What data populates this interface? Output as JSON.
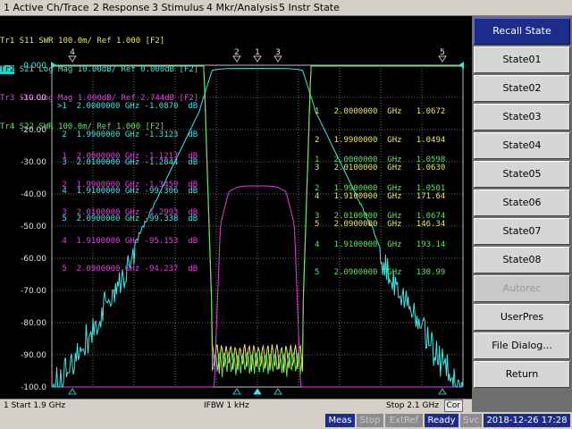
{
  "menu": [
    {
      "label": "1 Active Ch/Trace"
    },
    {
      "label": "2 Response"
    },
    {
      "label": "3 Stimulus"
    },
    {
      "label": "4 Mkr/Analysis"
    },
    {
      "label": "5 Instr State"
    }
  ],
  "traces": [
    {
      "label": "Tr1 S11 SWR 100.0m/ Ref 1.000 [F2]",
      "color": "#e6e65a"
    },
    {
      "label": "S21 Log Mag 10.00dB/ Ref 0.000dB [F2]",
      "tag": "Tr2",
      "color": "#3ce6e6"
    },
    {
      "label": "Tr3 S12 Log Mag 1.000dB/ Ref 2.744dB [F2]",
      "color": "#e63ce6"
    },
    {
      "label": "Tr4 S22 SWR 100.0m/ Ref 1.000 [F2]",
      "color": "#5ae65a"
    }
  ],
  "y_axis": {
    "ref_label": "0.000",
    "ticks": [
      "-10.00",
      "-20.00",
      "-30.00",
      "-40.00",
      "-50.00",
      "-60.00",
      "-70.00",
      "-80.00",
      "-90.00",
      "-100.0"
    ]
  },
  "marker_tables": {
    "s21": [
      ">1  2.0000000 GHz -1.0870  dB",
      " 2  1.9900000 GHz -1.3123  dB",
      " 3  2.0100000 GHz -1.2844  dB",
      " 4  1.9100000 GHz -99.306  dB",
      " 5  2.0900000 GHz -99.338  dB"
    ],
    "s12": [
      " 1  2.0000000 GHz -1.1217  dB",
      " 2  1.9900000 GHz -1.3459  dB",
      " 3  2.0100000 GHz -1.2993  dB",
      " 4  1.9100000 GHz -95.153  dB",
      " 5  2.0900000 GHz -94.237  dB"
    ],
    "s11": [
      "1   2.0000000  GHz   1.0672",
      "2   1.9900000  GHz   1.0494",
      "3   2.0100000  GHz   1.0630",
      "4   1.9100000  GHz   171.64",
      "5   2.0900000  GHz   146.34"
    ],
    "s22": [
      "1   2.0000000  GHz   1.0598",
      "2   1.9900000  GHz   1.0501",
      "3   2.0100000  GHz   1.0674",
      "4   1.9100000  GHz   193.14",
      "5   2.0900000  GHz   130.99"
    ]
  },
  "marker_flags": [
    "1",
    "2",
    "3",
    "4",
    "5"
  ],
  "status": {
    "start": "1  Start 1.9 GHz",
    "ifbw": "IFBW 1 kHz",
    "stop": "Stop 2.1 GHz",
    "cor": "Cor"
  },
  "bottom": {
    "meas": "Meas",
    "stop": "Stop",
    "extref": "ExtRef",
    "ready": "Ready",
    "svc": "Svc",
    "datetime": "2018-12-26 17:28"
  },
  "softkeys": [
    {
      "label": "Recall State",
      "kind": "title"
    },
    {
      "label": "State01"
    },
    {
      "label": "State02"
    },
    {
      "label": "State03"
    },
    {
      "label": "State04"
    },
    {
      "label": "State05"
    },
    {
      "label": "State06"
    },
    {
      "label": "State07"
    },
    {
      "label": "State08"
    },
    {
      "label": "Autorec",
      "kind": "disabled"
    },
    {
      "label": "UserPres"
    },
    {
      "label": "File Dialog..."
    },
    {
      "label": "Return"
    }
  ],
  "colors": {
    "s11": "#e6e65a",
    "s21": "#3ce6e6",
    "s12": "#e63ce6",
    "s22": "#5ae65a",
    "grid": "#c0c0c0"
  }
}
